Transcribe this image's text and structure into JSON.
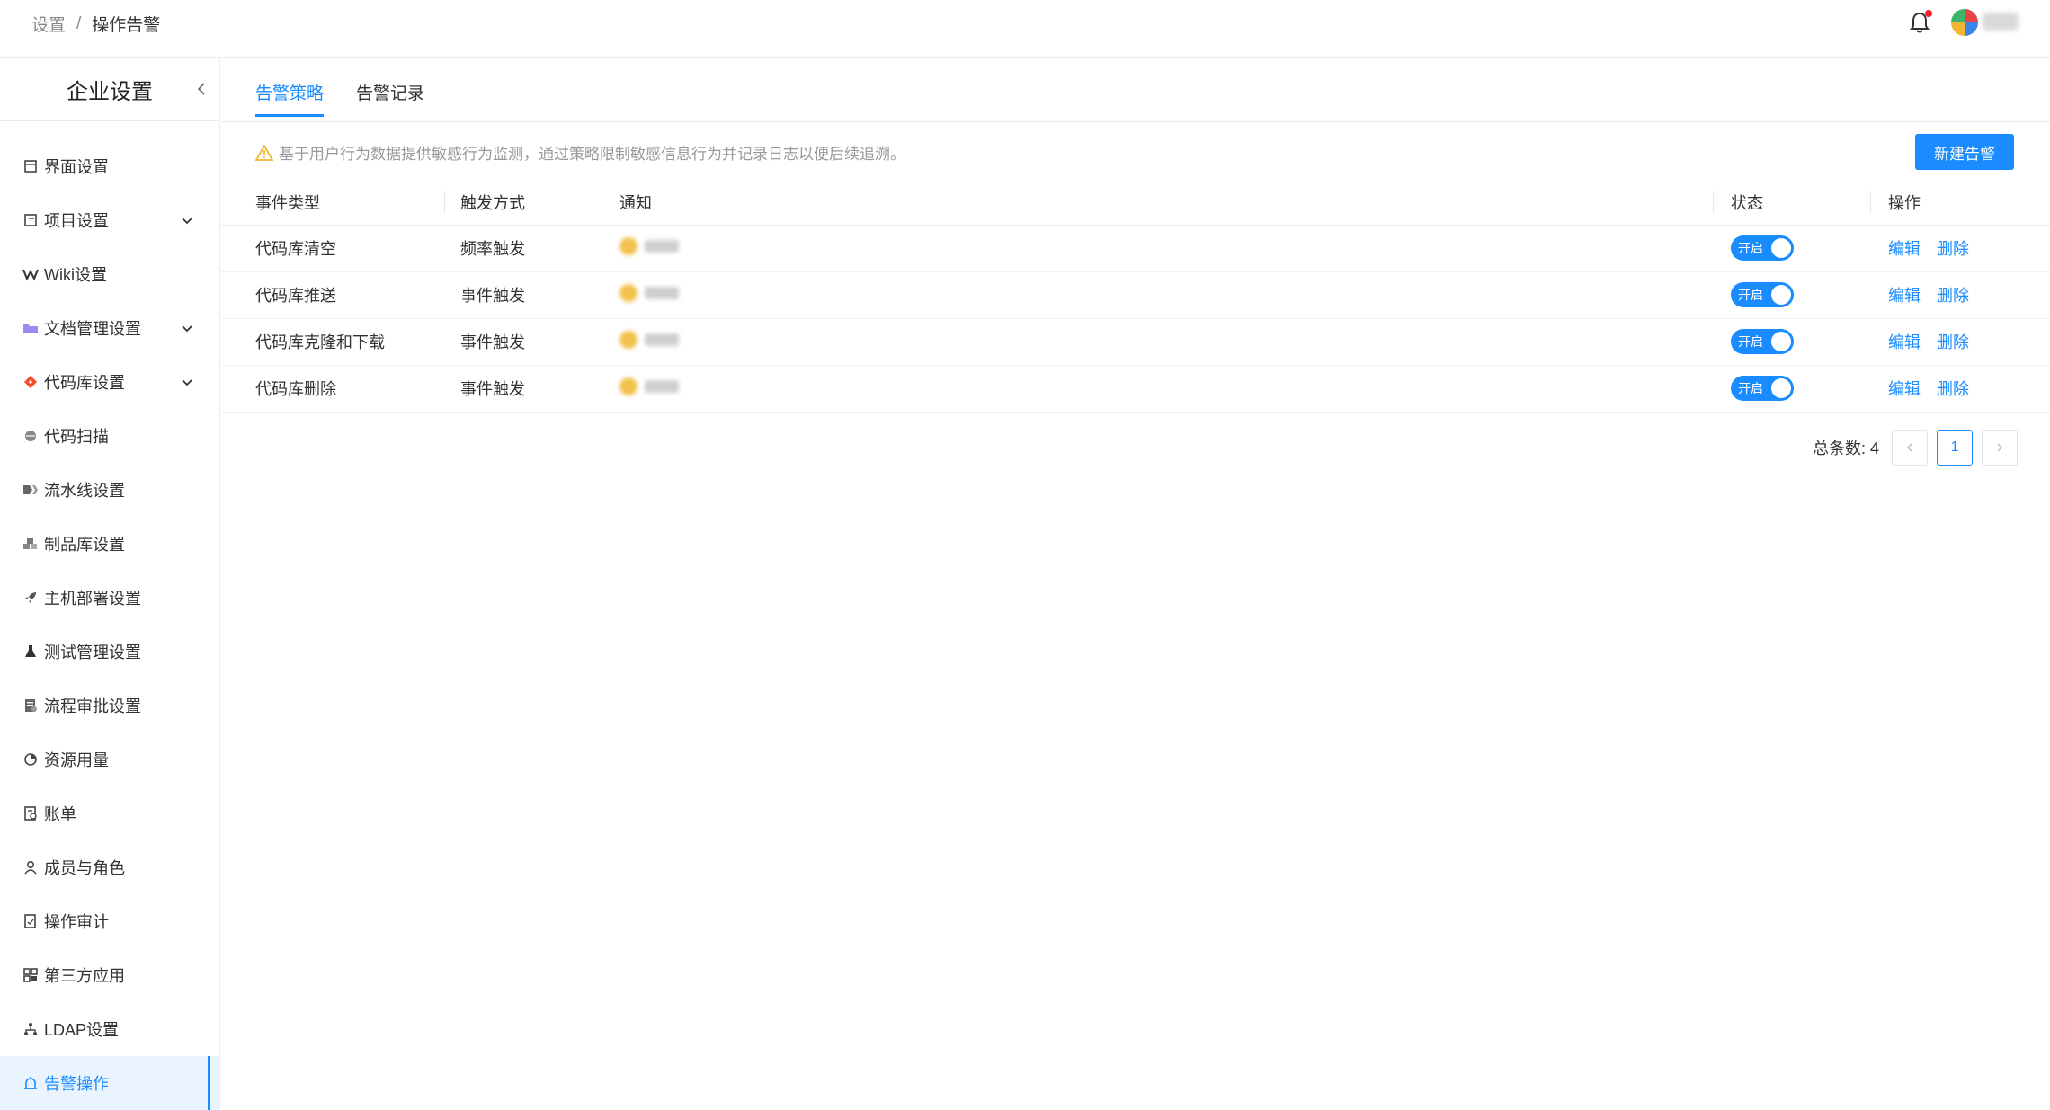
{
  "breadcrumb": {
    "parent": "设置",
    "separator": "/",
    "current": "操作告警"
  },
  "sidebar": {
    "title": "企业设置",
    "items": [
      {
        "label": "界面设置",
        "icon": "layout-icon",
        "expandable": false
      },
      {
        "label": "项目设置",
        "icon": "project-icon",
        "expandable": true
      },
      {
        "label": "Wiki设置",
        "icon": "wiki-icon",
        "expandable": false
      },
      {
        "label": "文档管理设置",
        "icon": "folder-icon",
        "expandable": true
      },
      {
        "label": "代码库设置",
        "icon": "git-icon",
        "expandable": true
      },
      {
        "label": "代码扫描",
        "icon": "scan-icon",
        "expandable": false
      },
      {
        "label": "流水线设置",
        "icon": "pipeline-icon",
        "expandable": false
      },
      {
        "label": "制品库设置",
        "icon": "artifact-icon",
        "expandable": false
      },
      {
        "label": "主机部署设置",
        "icon": "rocket-icon",
        "expandable": false
      },
      {
        "label": "测试管理设置",
        "icon": "flask-icon",
        "expandable": false
      },
      {
        "label": "流程审批设置",
        "icon": "approval-icon",
        "expandable": false
      },
      {
        "label": "资源用量",
        "icon": "pie-icon",
        "expandable": false
      },
      {
        "label": "账单",
        "icon": "bill-icon",
        "expandable": false
      },
      {
        "label": "成员与角色",
        "icon": "user-icon",
        "expandable": false
      },
      {
        "label": "操作审计",
        "icon": "audit-icon",
        "expandable": false
      },
      {
        "label": "第三方应用",
        "icon": "apps-icon",
        "expandable": false
      },
      {
        "label": "LDAP设置",
        "icon": "ldap-icon",
        "expandable": false
      },
      {
        "label": "告警操作",
        "icon": "alarm-icon",
        "expandable": false,
        "active": true
      }
    ]
  },
  "tabs": [
    {
      "label": "告警策略",
      "active": true
    },
    {
      "label": "告警记录",
      "active": false
    }
  ],
  "notice": "基于用户行为数据提供敏感行为监测，通过策略限制敏感信息行为并记录日志以便后续追溯。",
  "new_button": "新建告警",
  "table": {
    "headers": {
      "type": "事件类型",
      "trigger": "触发方式",
      "notify": "通知",
      "status": "状态",
      "op": "操作"
    },
    "rows": [
      {
        "type": "代码库清空",
        "trigger": "频率触发",
        "status": "开启"
      },
      {
        "type": "代码库推送",
        "trigger": "事件触发",
        "status": "开启"
      },
      {
        "type": "代码库克隆和下载",
        "trigger": "事件触发",
        "status": "开启"
      },
      {
        "type": "代码库删除",
        "trigger": "事件触发",
        "status": "开启"
      }
    ],
    "edit_label": "编辑",
    "delete_label": "删除"
  },
  "pagination": {
    "total_label": "总条数:",
    "total": "4",
    "current_page": "1"
  },
  "colors": {
    "accent": "#1a8cff",
    "warning": "#f2c14e",
    "notify_badge": "#f5222d"
  }
}
